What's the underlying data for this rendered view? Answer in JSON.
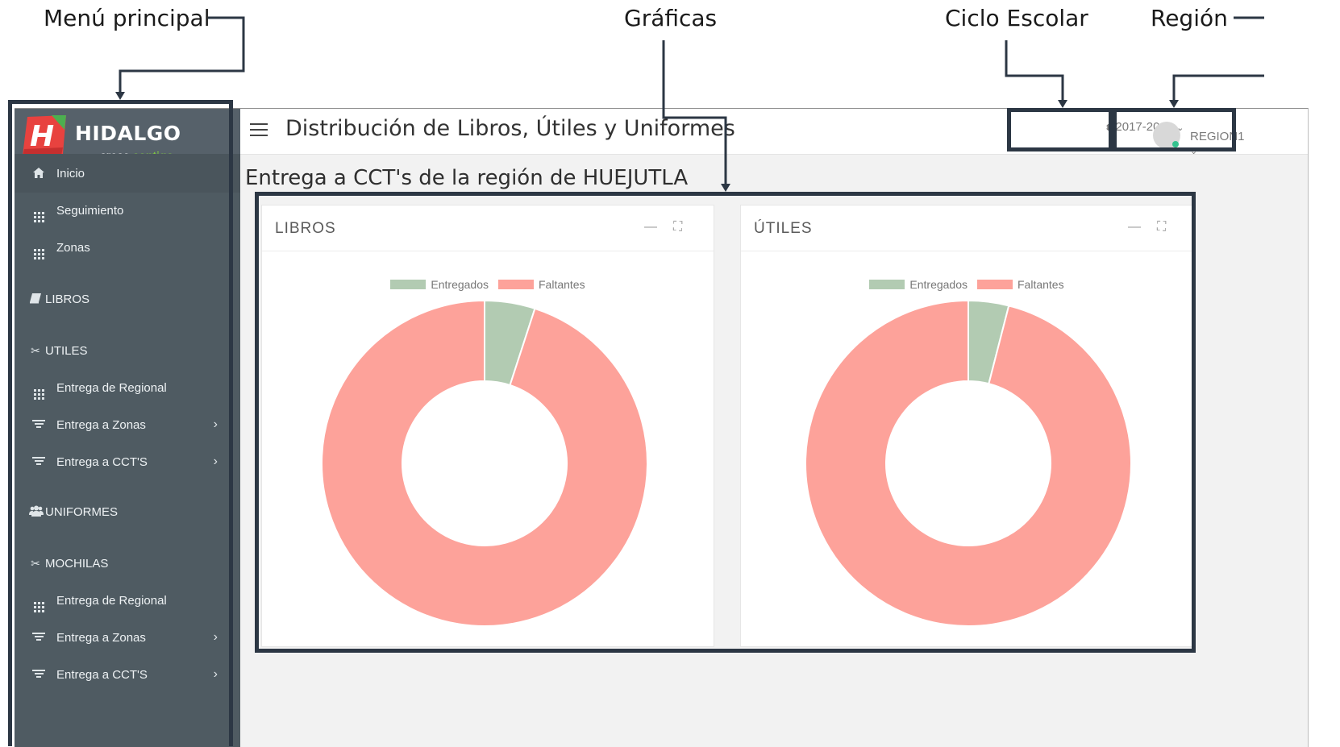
{
  "callouts": {
    "menu": "Menú principal",
    "graphs": "Gráficas",
    "cycle": "Ciclo Escolar",
    "region": "Región"
  },
  "brand": {
    "name": "HIDALGO",
    "tag_prefix": "crece",
    "tag_highlight": "contigo",
    "colors": {
      "red": "#e8423f",
      "green": "#4caf50"
    }
  },
  "sidebar": {
    "items": [
      {
        "label": "Inicio",
        "icon": "home-icon"
      },
      {
        "label": "Seguimiento",
        "icon": "grid-icon"
      },
      {
        "label": "Zonas",
        "icon": "grid-icon"
      },
      {
        "label": "LIBROS",
        "icon": "book-icon"
      },
      {
        "label": "UTILES",
        "icon": "scissors-icon"
      },
      {
        "label": "Entrega de Regional",
        "icon": "grid-icon"
      },
      {
        "label": "Entrega a Zonas",
        "icon": "filter-icon"
      },
      {
        "label": "Entrega a CCT'S",
        "icon": "filter-icon"
      },
      {
        "label": "UNIFORMES",
        "icon": "users-icon"
      },
      {
        "label": "MOCHILAS",
        "icon": "scissors-icon"
      },
      {
        "label": "Entrega de Regional",
        "icon": "grid-icon"
      },
      {
        "label": "Entrega a Zonas",
        "icon": "filter-icon"
      },
      {
        "label": "Entrega a CCT'S",
        "icon": "filter-icon"
      }
    ]
  },
  "header": {
    "title": "Distribución de Libros, Útiles y Uniformes",
    "cycle": "2017-2018",
    "region": "REGION1"
  },
  "page": {
    "heading": "Entrega a CCT's de la región de HUEJUTLA"
  },
  "colors": {
    "delivered": "#b2cbb2",
    "missing": "#fda29a"
  },
  "chart_data": [
    {
      "type": "pie",
      "title": "LIBROS",
      "donut": true,
      "categories": [
        "Entregados",
        "Faltantes"
      ],
      "values": [
        5,
        95
      ],
      "legend": "top-center"
    },
    {
      "type": "pie",
      "title": "ÚTILES",
      "donut": true,
      "categories": [
        "Entregados",
        "Faltantes"
      ],
      "values": [
        4,
        96
      ],
      "legend": "top-center"
    }
  ]
}
